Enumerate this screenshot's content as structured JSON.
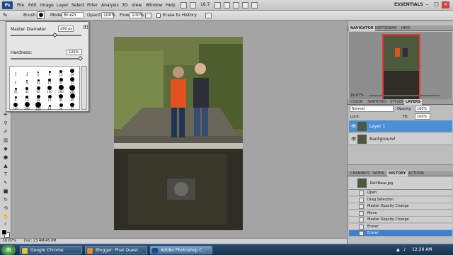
{
  "app": {
    "logo": "Ps"
  },
  "menu": [
    "File",
    "Edit",
    "Image",
    "Layer",
    "Select",
    "Filter",
    "Analysis",
    "3D",
    "View",
    "Window",
    "Help"
  ],
  "zoom": "16.7",
  "workspace": "ESSENTIALS",
  "options": {
    "brush_label": "Brush:",
    "brush_size": "290",
    "mode_label": "Mode:",
    "mode_value": "Brush",
    "opacity_label": "Opacity:",
    "opacity_value": "100%",
    "flow_label": "Flow:",
    "flow_value": "100%",
    "erase_history_label": "Erase to History"
  },
  "brush_panel": {
    "diameter_label": "Master Diameter",
    "diameter_value": "290 px",
    "diameter_level": 0.62,
    "hardness_label": "Hardness:",
    "hardness_value": "100%",
    "hardness_level": 1.0,
    "presets": [
      {
        "n": "1",
        "s": 1
      },
      {
        "n": "3",
        "s": 1
      },
      {
        "n": "5",
        "s": 2
      },
      {
        "n": "9",
        "s": 3
      },
      {
        "n": "13",
        "s": 4
      },
      {
        "n": "19",
        "s": 6
      },
      {
        "n": "5",
        "s": 1
      },
      {
        "n": "9",
        "s": 2
      },
      {
        "n": "13",
        "s": 3
      },
      {
        "n": "17",
        "s": 4
      },
      {
        "n": "21",
        "s": 5
      },
      {
        "n": "27",
        "s": 6
      },
      {
        "n": "35",
        "s": 3
      },
      {
        "n": "45",
        "s": 4
      },
      {
        "n": "65",
        "s": 5
      },
      {
        "n": "100",
        "s": 6
      },
      {
        "n": "200",
        "s": 7
      },
      {
        "n": "300",
        "s": 8
      },
      {
        "n": "9",
        "s": 3
      },
      {
        "n": "13",
        "s": 4
      },
      {
        "n": "19",
        "s": 5
      },
      {
        "n": "17",
        "s": 5
      },
      {
        "n": "45",
        "s": 6
      },
      {
        "n": "65",
        "s": 7
      },
      {
        "n": "100",
        "s": 6
      },
      {
        "n": "200",
        "s": 7
      },
      {
        "n": "300",
        "s": 8
      },
      {
        "n": "14",
        "s": 3
      },
      {
        "n": "24",
        "s": 5
      },
      {
        "n": "27",
        "s": 6
      }
    ]
  },
  "doc_status": {
    "zoom": "16.67%",
    "doc": "Doc: 23.4M/45.0M"
  },
  "panels": {
    "top_tabs": [
      "NAVIGATOR",
      "HISTOGRAM",
      "INFO"
    ],
    "nav_zoom": "16.67%",
    "mid_tabs": [
      "COLOR",
      "SWATCHES",
      "STYLES",
      "LAYERS"
    ],
    "blend_mode": "Normal",
    "opacity_label": "Opacity:",
    "opacity_value": "100%",
    "lock_label": "Lock:",
    "fill_label": "Fill:",
    "fill_value": "100%",
    "layers": [
      {
        "name": "Layer 1",
        "selected": true
      },
      {
        "name": "Background",
        "selected": false
      }
    ],
    "bottom_tabs": [
      "CHANNELS",
      "PATHS",
      "HISTORY",
      "ACTIONS"
    ],
    "snapshot": "Rolf.Base.jpg",
    "history": [
      {
        "name": "Open",
        "selected": false
      },
      {
        "name": "Drag Selection",
        "selected": false
      },
      {
        "name": "Master Opacity Change",
        "selected": false
      },
      {
        "name": "Move",
        "selected": false
      },
      {
        "name": "Master Opacity Change",
        "selected": false
      },
      {
        "name": "Eraser",
        "selected": false
      },
      {
        "name": "Eraser",
        "selected": true
      }
    ]
  },
  "taskbar": {
    "items": [
      {
        "label": "Google Chrome",
        "color": "#e8c33a",
        "active": false
      },
      {
        "label": "Blogger: Phat Quest...",
        "color": "#f08a24",
        "active": false
      },
      {
        "label": "Adobe Photoshop C...",
        "color": "#1a4a8c",
        "active": true
      }
    ],
    "clock": "12:29 AM"
  }
}
